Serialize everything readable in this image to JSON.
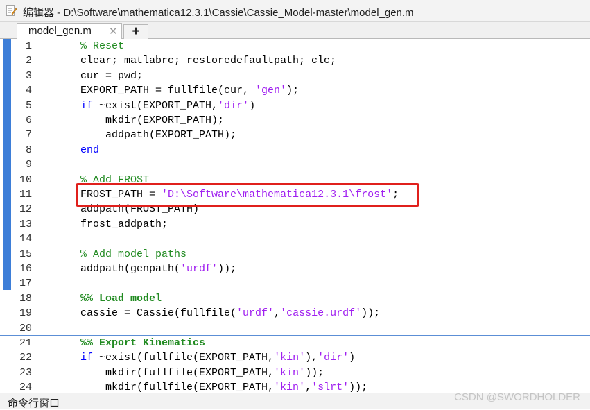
{
  "window": {
    "title": "编辑器 - D:\\Software\\mathematica12.3.1\\Cassie\\Cassie_Model-master\\model_gen.m"
  },
  "tabs": [
    {
      "label": "model_gen.m",
      "close": "✕"
    }
  ],
  "add_tab_label": "+",
  "editor": {
    "lines": [
      {
        "n": "1",
        "segs": [
          {
            "t": "% Reset",
            "c": "comment"
          }
        ]
      },
      {
        "n": "2",
        "segs": [
          {
            "t": "clear; matlabrc; restoredefaultpath; clc;"
          }
        ]
      },
      {
        "n": "3",
        "segs": [
          {
            "t": "cur = pwd;"
          }
        ]
      },
      {
        "n": "4",
        "segs": [
          {
            "t": "EXPORT_PATH = fullfile(cur, "
          },
          {
            "t": "'gen'",
            "c": "str"
          },
          {
            "t": ");"
          }
        ]
      },
      {
        "n": "5",
        "segs": [
          {
            "t": "if",
            "c": "kw"
          },
          {
            "t": " ~exist(EXPORT_PATH,"
          },
          {
            "t": "'dir'",
            "c": "str"
          },
          {
            "t": ")"
          }
        ]
      },
      {
        "n": "6",
        "segs": [
          {
            "t": "    mkdir(EXPORT_PATH);"
          }
        ]
      },
      {
        "n": "7",
        "segs": [
          {
            "t": "    addpath(EXPORT_PATH);"
          }
        ]
      },
      {
        "n": "8",
        "segs": [
          {
            "t": "end",
            "c": "kw"
          }
        ]
      },
      {
        "n": "9",
        "segs": []
      },
      {
        "n": "10",
        "segs": [
          {
            "t": "% Add FROST",
            "c": "comment"
          }
        ]
      },
      {
        "n": "11",
        "segs": [
          {
            "t": "FROST_PATH = "
          },
          {
            "t": "'D:\\Software\\mathematica12.3.1\\frost'",
            "c": "str"
          },
          {
            "t": ";"
          }
        ]
      },
      {
        "n": "12",
        "segs": [
          {
            "t": "addpath(FROST_PATH)"
          }
        ]
      },
      {
        "n": "13",
        "segs": [
          {
            "t": "frost_addpath;"
          }
        ]
      },
      {
        "n": "14",
        "segs": []
      },
      {
        "n": "15",
        "segs": [
          {
            "t": "% Add model paths",
            "c": "comment"
          }
        ]
      },
      {
        "n": "16",
        "segs": [
          {
            "t": "addpath(genpath("
          },
          {
            "t": "'urdf'",
            "c": "str"
          },
          {
            "t": "));"
          }
        ]
      },
      {
        "n": "17",
        "segs": []
      },
      {
        "n": "18",
        "segs": [
          {
            "t": "%% Load model",
            "c": "cell"
          }
        ]
      },
      {
        "n": "19",
        "segs": [
          {
            "t": "cassie = Cassie(fullfile("
          },
          {
            "t": "'urdf'",
            "c": "str"
          },
          {
            "t": ","
          },
          {
            "t": "'cassie.urdf'",
            "c": "str"
          },
          {
            "t": "));"
          }
        ]
      },
      {
        "n": "20",
        "segs": []
      },
      {
        "n": "21",
        "segs": [
          {
            "t": "%% Export Kinematics",
            "c": "cell"
          }
        ]
      },
      {
        "n": "22",
        "segs": [
          {
            "t": "if",
            "c": "kw"
          },
          {
            "t": " ~exist(fullfile(EXPORT_PATH,"
          },
          {
            "t": "'kin'",
            "c": "str"
          },
          {
            "t": "),"
          },
          {
            "t": "'dir'",
            "c": "str"
          },
          {
            "t": ")"
          }
        ]
      },
      {
        "n": "23",
        "segs": [
          {
            "t": "    mkdir(fullfile(EXPORT_PATH,"
          },
          {
            "t": "'kin'",
            "c": "str"
          },
          {
            "t": "));"
          }
        ]
      },
      {
        "n": "24",
        "segs": [
          {
            "t": "    mkdir(fullfile(EXPORT_PATH,"
          },
          {
            "t": "'kin'",
            "c": "str"
          },
          {
            "t": ","
          },
          {
            "t": "'slrt'",
            "c": "str"
          },
          {
            "t": "));"
          }
        ]
      }
    ]
  },
  "command_window": {
    "label": "命令行窗口"
  },
  "watermark": "CSDN @SWORDHOLDER",
  "colors": {
    "comment": "#228b22",
    "keyword": "#0000ff",
    "string": "#a020f0",
    "highlight_box": "#e0201c",
    "section_marker": "#3d7ed8"
  }
}
